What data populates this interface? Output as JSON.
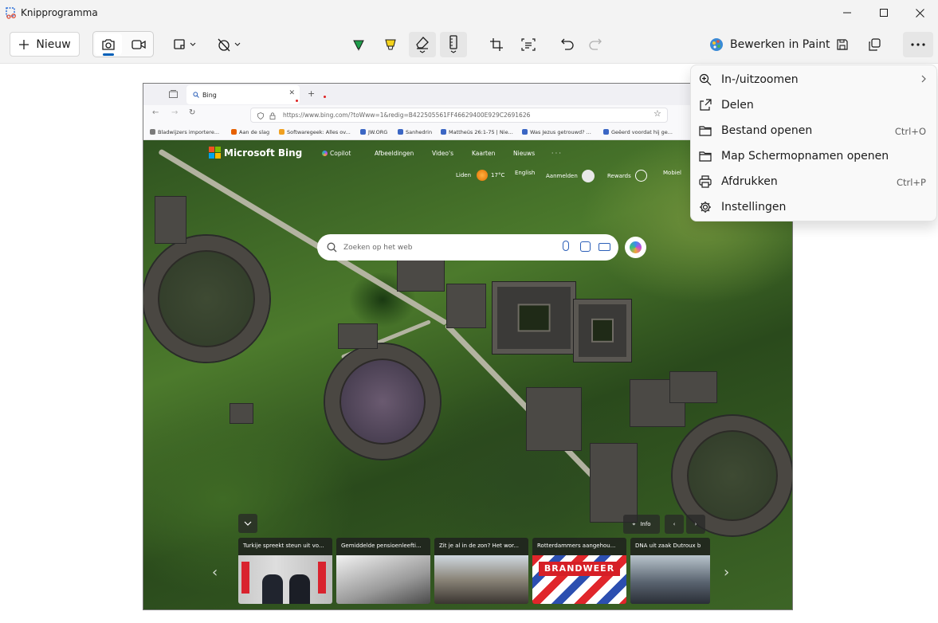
{
  "app": {
    "title": "Knipprogramma"
  },
  "toolbar": {
    "new_label": "Nieuw",
    "paint_label": "Bewerken in Paint"
  },
  "menu": {
    "items": [
      {
        "label": "In-/uitzoomen",
        "shortcut": "",
        "icon": "zoom-icon"
      },
      {
        "label": "Delen",
        "shortcut": "",
        "icon": "share-icon"
      },
      {
        "label": "Bestand openen",
        "shortcut": "Ctrl+O",
        "icon": "folder-icon"
      },
      {
        "label": "Map Schermopnamen openen",
        "shortcut": "",
        "icon": "folder-icon"
      },
      {
        "label": "Afdrukken",
        "shortcut": "Ctrl+P",
        "icon": "printer-icon"
      },
      {
        "label": "Instellingen",
        "shortcut": "",
        "icon": "gear-icon"
      }
    ]
  },
  "screenshot": {
    "tab_title": "Bing",
    "url": "https://www.bing.com/?toWww=1&redig=B422505561FF46629400E929C2691626",
    "bookmarks": [
      "Bladwijzers importere...",
      "Aan de slag",
      "Softwaregeek: Alles ov...",
      "JW.ORG",
      "Sanhedrin",
      "Mattheüs 26:1-75 | Nie...",
      "Was Jezus getrouwd? ...",
      "Geëerd voordat hij ge..."
    ],
    "bing": {
      "logo": "Microsoft Bing",
      "nav": [
        "Copilot",
        "Afbeeldingen",
        "Video's",
        "Kaarten",
        "Nieuws",
        "· · ·"
      ],
      "city": "Liden",
      "temp": "17°C",
      "language": "English",
      "signin": "Aanmelden",
      "rewards": "Rewards",
      "mobile": "Mobiel",
      "search_placeholder": "Zoeken op het web",
      "info_label": "Info",
      "news": [
        "Turkije spreekt steun uit vo...",
        "Gemiddelde pensioenleefti...",
        "Zit je al in de zon? Het wor...",
        "Rotterdammers aangehou...",
        "DNA uit zaak Dutroux b"
      ],
      "banner": "BRANDWEER"
    }
  }
}
